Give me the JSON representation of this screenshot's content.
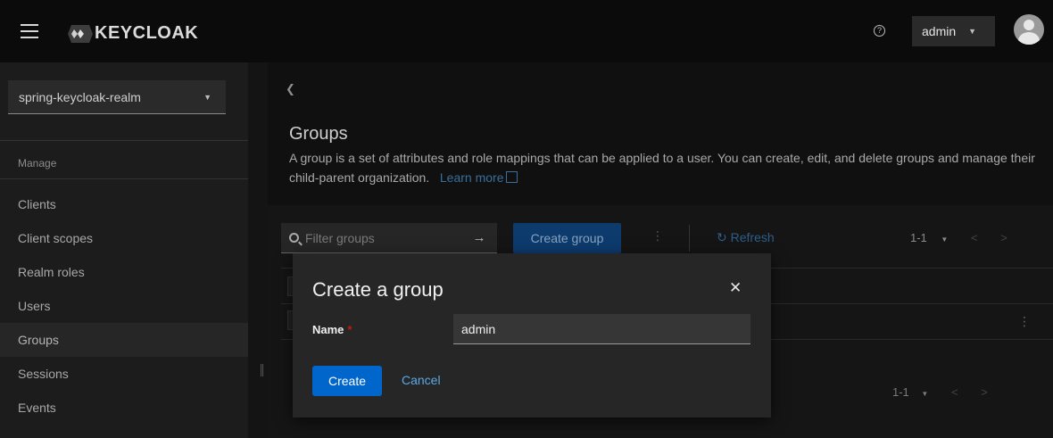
{
  "header": {
    "brand": "KEYCLOAK",
    "help_icon": "help-icon",
    "user_label": "admin"
  },
  "sidebar": {
    "realm": "spring-keycloak-realm",
    "group_title": "Manage",
    "items": [
      {
        "label": "Clients"
      },
      {
        "label": "Client scopes"
      },
      {
        "label": "Realm roles"
      },
      {
        "label": "Users"
      },
      {
        "label": "Groups",
        "active": true
      },
      {
        "label": "Sessions"
      },
      {
        "label": "Events"
      }
    ]
  },
  "main": {
    "title": "Groups",
    "description": "A group is a set of attributes and role mappings that can be applied to a user. You can create, edit, and delete groups and manage their child-parent organization.",
    "learn_more": "Learn more",
    "toolbar": {
      "filter_placeholder": "Filter groups",
      "create_label": "Create group",
      "refresh_label": "Refresh",
      "pagination": "1-1"
    },
    "pagination_bottom": "1-1"
  },
  "modal": {
    "title": "Create a group",
    "name_label": "Name",
    "required_mark": "*",
    "name_value": "admin",
    "create_label": "Create",
    "cancel_label": "Cancel"
  },
  "colors": {
    "primary": "#0066cc",
    "link": "#5aa9e6",
    "required": "#c9190b"
  }
}
